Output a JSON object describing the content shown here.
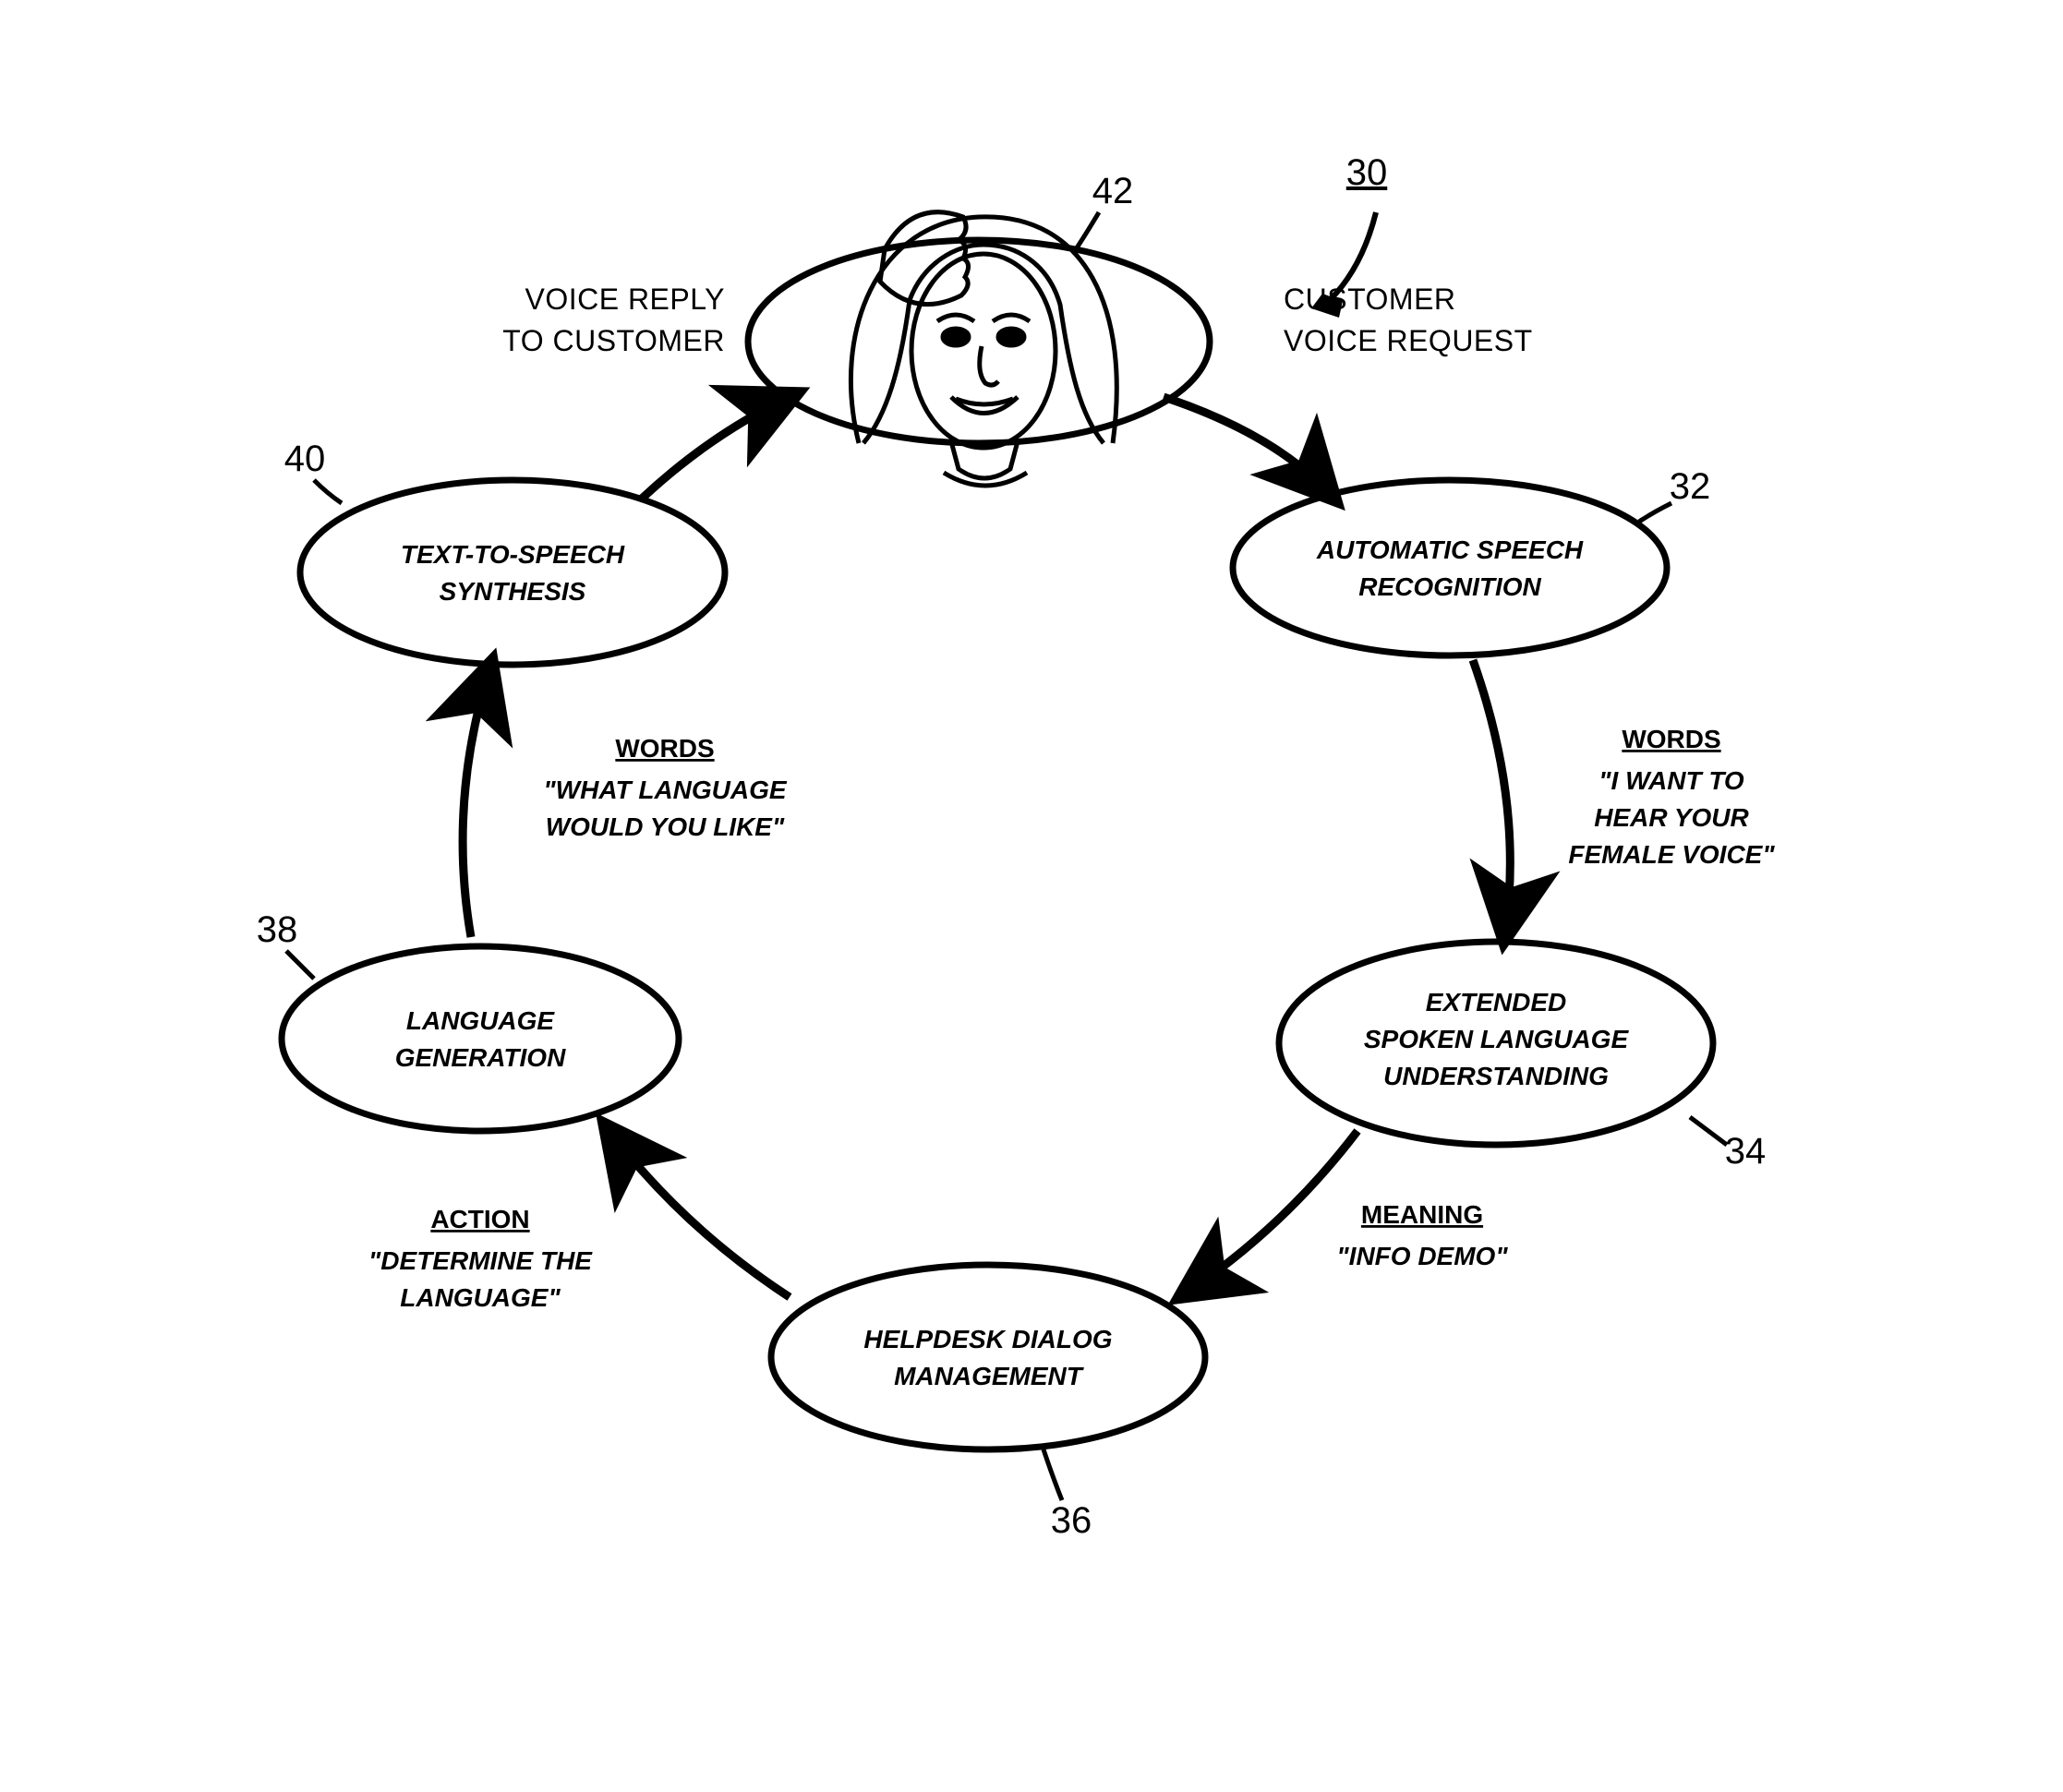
{
  "figure_ref": "30",
  "nodes": {
    "n42": {
      "ref": "42"
    },
    "n32": {
      "ref": "32",
      "l1": "AUTOMATIC SPEECH",
      "l2": "RECOGNITION"
    },
    "n34": {
      "ref": "34",
      "l1": "EXTENDED",
      "l2": "SPOKEN LANGUAGE",
      "l3": "UNDERSTANDING"
    },
    "n36": {
      "ref": "36",
      "l1": "HELPDESK DIALOG",
      "l2": "MANAGEMENT"
    },
    "n38": {
      "ref": "38",
      "l1": "LANGUAGE",
      "l2": "GENERATION"
    },
    "n40": {
      "ref": "40",
      "l1": "TEXT-TO-SPEECH",
      "l2": "SYNTHESIS"
    }
  },
  "edges": {
    "e42_32": {
      "l1": "CUSTOMER",
      "l2": "VOICE REQUEST"
    },
    "e40_42": {
      "l1": "VOICE REPLY",
      "l2": "TO CUSTOMER"
    },
    "e32_34": {
      "head": "WORDS",
      "q1": "\"I WANT TO",
      "q2": "HEAR YOUR",
      "q3": "FEMALE VOICE\""
    },
    "e34_36": {
      "head": "MEANING",
      "q1": "\"INFO DEMO\""
    },
    "e36_38": {
      "head": "ACTION",
      "q1": "\"DETERMINE THE",
      "q2": "LANGUAGE\""
    },
    "e38_40": {
      "head": "WORDS",
      "q1": "\"WHAT LANGUAGE",
      "q2": "WOULD YOU LIKE\""
    }
  }
}
